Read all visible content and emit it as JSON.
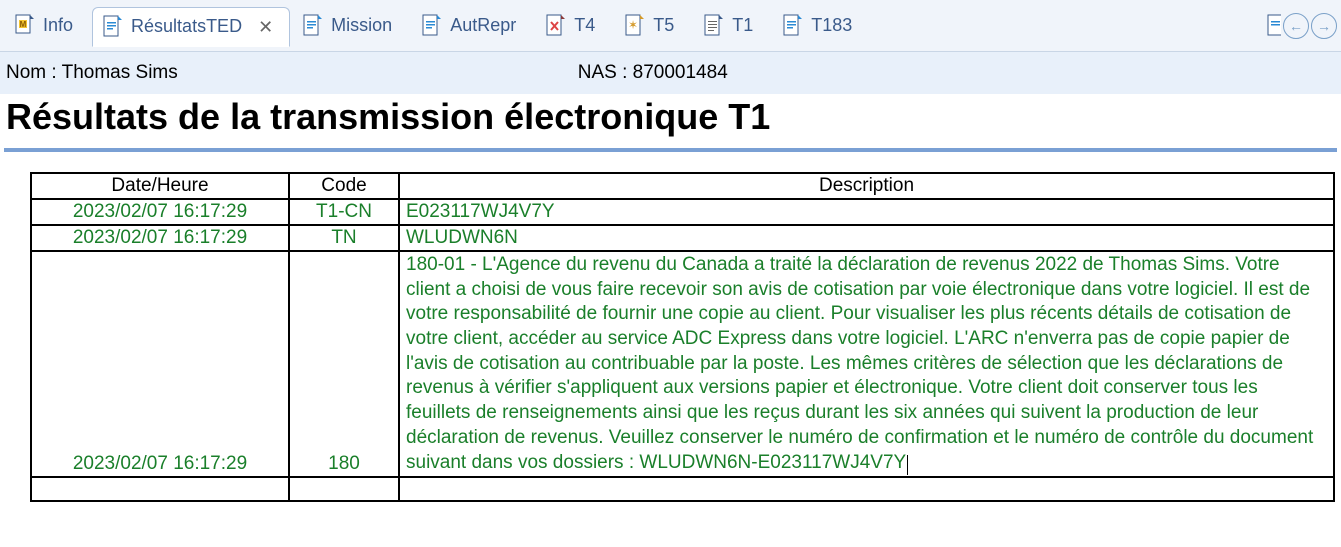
{
  "tabs": [
    {
      "label": "Info",
      "icon": "info"
    },
    {
      "label": "RésultatsTED",
      "icon": "doc-blue",
      "active": true,
      "closable": true
    },
    {
      "label": "Mission",
      "icon": "doc-blue"
    },
    {
      "label": "AutRepr",
      "icon": "doc-blue"
    },
    {
      "label": "T4",
      "icon": "doc-x"
    },
    {
      "label": "T5",
      "icon": "doc-star"
    },
    {
      "label": "T1",
      "icon": "doc-lines"
    },
    {
      "label": "T183",
      "icon": "doc-blue"
    }
  ],
  "meta": {
    "name_label": "Nom : ",
    "name_value": "Thomas Sims",
    "sin_label": "NAS : ",
    "sin_value": "870001484"
  },
  "title": "Résultats de la transmission électronique T1",
  "columns": {
    "datetime": "Date/Heure",
    "code": "Code",
    "description": "Description"
  },
  "rows": [
    {
      "datetime": "2023/02/07 16:17:29",
      "code": "T1-CN",
      "description": "E023117WJ4V7Y"
    },
    {
      "datetime": "2023/02/07 16:17:29",
      "code": "TN",
      "description": "WLUDWN6N"
    },
    {
      "datetime": "2023/02/07 16:17:29",
      "code": "180",
      "description": "180-01 - L'Agence du revenu du Canada a traité la déclaration de revenus 2022 de Thomas Sims. Votre client a choisi de vous faire recevoir son avis de cotisation par voie électronique dans votre logiciel. Il est de votre responsabilité de fournir une copie au client. Pour visualiser les plus récents détails de cotisation de votre client, accéder au service ADC Express dans votre logiciel. L'ARC n'enverra pas de copie papier de l'avis de cotisation au contribuable par la poste. Les mêmes critères de sélection que les déclarations de revenus à vérifier s'appliquent aux versions papier et électronique. Votre client doit conserver tous les feuillets de renseignements ainsi que les reçus durant les six années qui suivent la production de leur déclaration de revenus. Veuillez conserver le numéro de confirmation et le numéro de contrôle du document suivant dans vos dossiers : WLUDWN6N-E023117WJ4V7Y"
    }
  ]
}
